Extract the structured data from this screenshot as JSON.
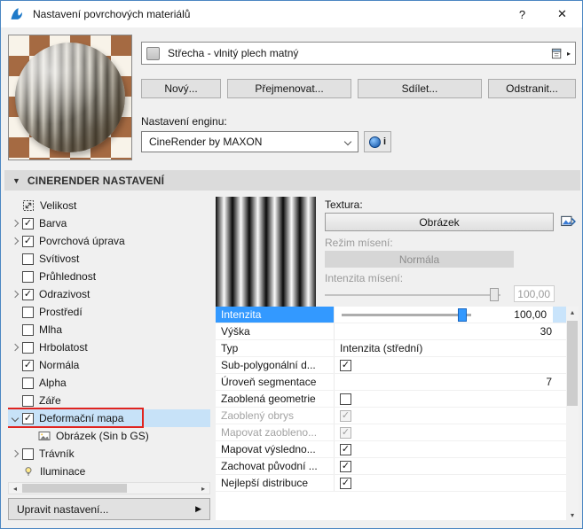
{
  "window": {
    "title": "Nastavení povrchových materiálů",
    "help_label": "?",
    "close_label": "✕"
  },
  "material": {
    "name": "Střecha - vlnitý plech matný",
    "buttons": {
      "new": "Nový...",
      "rename": "Přejmenovat...",
      "share": "Sdílet...",
      "delete": "Odstranit..."
    },
    "engine_label": "Nastavení enginu:",
    "engine_value": "CineRender by MAXON",
    "info_label": "i"
  },
  "section": {
    "title": "CINERENDER NASTAVENÍ"
  },
  "tree": {
    "items": [
      {
        "label": "Velikost",
        "icon": "size"
      },
      {
        "label": "Barva",
        "arrow": "collapsed",
        "checkbox": true,
        "checked": true
      },
      {
        "label": "Povrchová úprava",
        "arrow": "collapsed",
        "checkbox": true,
        "checked": true
      },
      {
        "label": "Svítivost",
        "checkbox": true,
        "checked": false
      },
      {
        "label": "Průhlednost",
        "checkbox": true,
        "checked": false
      },
      {
        "label": "Odrazivost",
        "arrow": "collapsed",
        "checkbox": true,
        "checked": true
      },
      {
        "label": "Prostředí",
        "checkbox": true,
        "checked": false
      },
      {
        "label": "Mlha",
        "checkbox": true,
        "checked": false
      },
      {
        "label": "Hrbolatost",
        "arrow": "collapsed",
        "checkbox": true,
        "checked": false
      },
      {
        "label": "Normála",
        "checkbox": true,
        "checked": true
      },
      {
        "label": "Alpha",
        "checkbox": true,
        "checked": false
      },
      {
        "label": "Záře",
        "checkbox": true,
        "checked": false
      },
      {
        "label": "Deformační mapa",
        "arrow": "expanded",
        "checkbox": true,
        "checked": true,
        "selected": true,
        "annotated": true
      },
      {
        "label": "Obrázek (Sin b GS)",
        "icon": "image",
        "indent": 1
      },
      {
        "label": "Trávník",
        "arrow": "collapsed",
        "checkbox": true,
        "checked": false
      },
      {
        "label": "Iluminace",
        "icon": "lamp"
      }
    ],
    "edit_button": "Upravit nastavení..."
  },
  "texture": {
    "label": "Textura:",
    "image_button": "Obrázek",
    "blend_mode_label": "Režim mísení:",
    "blend_mode_value": "Normála",
    "blend_intensity_label": "Intenzita mísení:",
    "blend_intensity_value": "100,00"
  },
  "properties": {
    "rows": [
      {
        "label": "Intenzita",
        "type": "slider",
        "value": "100,00",
        "selected": true
      },
      {
        "label": "Výška",
        "type": "number",
        "value": "30"
      },
      {
        "label": "Typ",
        "type": "text",
        "value": "Intenzita (střední)"
      },
      {
        "label": "Sub-polygonální d...",
        "type": "checkbox",
        "checked": true
      },
      {
        "label": "Úroveň segmentace",
        "type": "number",
        "value": "7"
      },
      {
        "label": "Zaoblená geometrie",
        "type": "checkbox",
        "checked": false
      },
      {
        "label": "Zaoblený obrys",
        "type": "checkbox",
        "checked": true,
        "disabled": true
      },
      {
        "label": "Mapovat zaobleno...",
        "type": "checkbox",
        "checked": true,
        "disabled": true
      },
      {
        "label": "Mapovat výsledno...",
        "type": "checkbox",
        "checked": true
      },
      {
        "label": "Zachovat původní ...",
        "type": "checkbox",
        "checked": true
      },
      {
        "label": "Nejlepší distribuce",
        "type": "checkbox",
        "checked": true
      }
    ]
  },
  "colors": {
    "selection_blue": "#3399ff",
    "selection_light": "#c9e4fb",
    "tree_selection": "#c7e2f8",
    "annotation_red": "#e0241f",
    "engine_icon_blue": "#0b4ea2"
  }
}
